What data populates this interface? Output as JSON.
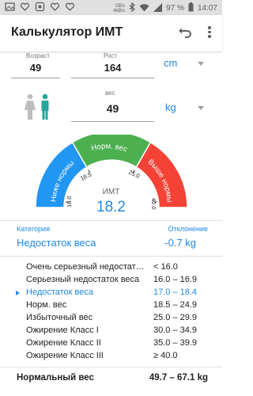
{
  "status_bar": {
    "net_top": "0B/s",
    "net_bottom": "4kB/s",
    "battery": "97 %",
    "time": "14:07"
  },
  "app_bar": {
    "title": "Калькулятор ИМТ"
  },
  "inputs": {
    "age_label": "Возраст",
    "age_value": "49",
    "height_label": "Рост",
    "height_value": "164",
    "height_unit": "cm",
    "weight_label": "вес",
    "weight_value": "49",
    "weight_unit": "kg"
  },
  "gauge": {
    "left_label": "Ниже нормы",
    "center_label": "Норм. вес",
    "right_label": "Выше нормы",
    "ticks": [
      "16.0",
      "18.5",
      "25.0",
      "40.0"
    ],
    "imt_label": "ИМТ",
    "imt_value": "18.2",
    "colors": {
      "low": "#2196f3",
      "normal": "#4caf50",
      "high": "#f44336"
    }
  },
  "category": {
    "header": "Категория",
    "value": "Недостаток веса",
    "deviation_header": "Отклонение",
    "deviation_value": "-0.7 kg"
  },
  "ranges": [
    {
      "name": "Очень серьезный недостат…",
      "range": "< 16.0"
    },
    {
      "name": "Серьезный недостаток веса",
      "range": "16.0 – 16.9"
    },
    {
      "name": "Недостаток веса",
      "range": "17.0 – 18.4",
      "selected": true
    },
    {
      "name": "Норм. вес",
      "range": "18.5 – 24.9"
    },
    {
      "name": "Избыточный вес",
      "range": "25.0 – 29.9"
    },
    {
      "name": "Ожирение Класс I",
      "range": "30.0 – 34.9"
    },
    {
      "name": "Ожирение Класс II",
      "range": "35.0 – 39.9"
    },
    {
      "name": "Ожирение Класс III",
      "range": "≥ 40.0"
    }
  ],
  "normal_weight": {
    "label": "Нормальный вес",
    "value": "49.7 – 67.1 kg"
  }
}
